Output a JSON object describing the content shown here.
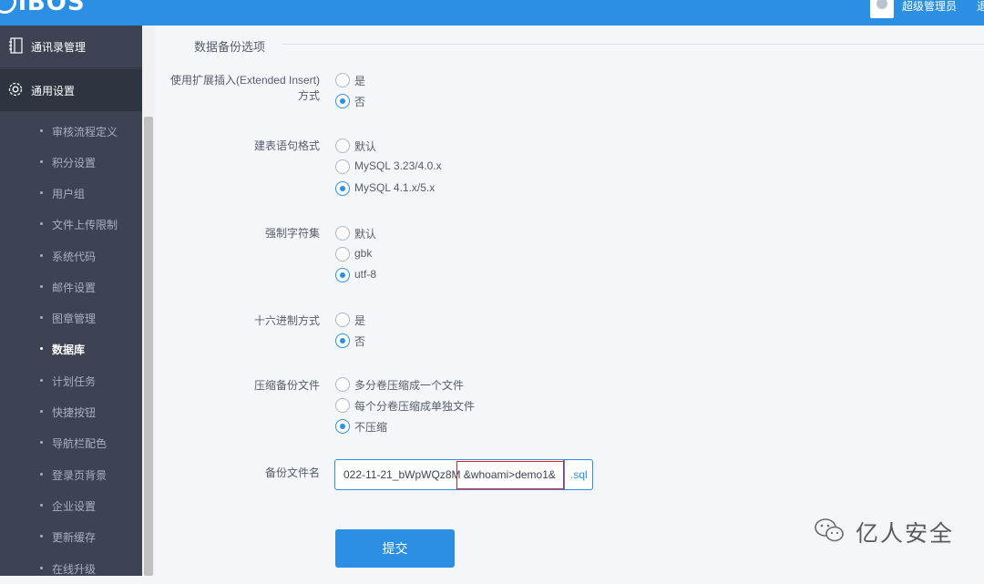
{
  "header": {
    "logo": "iBOS",
    "user_name": "超级管理员",
    "logout": "退"
  },
  "sidebar": {
    "groups": [
      {
        "label": "通讯录管理",
        "icon": "address-book-icon"
      },
      {
        "label": "通用设置",
        "icon": "gear-icon"
      }
    ],
    "items": [
      {
        "label": "审核流程定义"
      },
      {
        "label": "积分设置"
      },
      {
        "label": "用户组"
      },
      {
        "label": "文件上传限制"
      },
      {
        "label": "系统代码"
      },
      {
        "label": "邮件设置"
      },
      {
        "label": "图章管理"
      },
      {
        "label": "数据库",
        "active": true
      },
      {
        "label": "计划任务"
      },
      {
        "label": "快捷按钮"
      },
      {
        "label": "导航栏配色"
      },
      {
        "label": "登录页背景"
      },
      {
        "label": "企业设置"
      },
      {
        "label": "更新缓存"
      },
      {
        "label": "在线升级"
      }
    ]
  },
  "main": {
    "section_title": "数据备份选项",
    "fields": [
      {
        "label": "使用扩展插入(Extended Insert)方式",
        "options": [
          {
            "text": "是",
            "checked": false
          },
          {
            "text": "否",
            "checked": true
          }
        ]
      },
      {
        "label": "建表语句格式",
        "options": [
          {
            "text": "默认",
            "checked": false
          },
          {
            "text": "MySQL 3.23/4.0.x",
            "checked": false
          },
          {
            "text": "MySQL 4.1.x/5.x",
            "checked": true
          }
        ]
      },
      {
        "label": "强制字符集",
        "options": [
          {
            "text": "默认",
            "checked": false
          },
          {
            "text": "gbk",
            "checked": false
          },
          {
            "text": "utf-8",
            "checked": true
          }
        ]
      },
      {
        "label": "十六进制方式",
        "options": [
          {
            "text": "是",
            "checked": false
          },
          {
            "text": "否",
            "checked": true
          }
        ]
      },
      {
        "label": "压缩备份文件",
        "options": [
          {
            "text": "多分卷压缩成一个文件",
            "checked": false
          },
          {
            "text": "每个分卷压缩成单独文件",
            "checked": false
          },
          {
            "text": "不压缩",
            "checked": true
          }
        ]
      }
    ],
    "filename": {
      "label": "备份文件名",
      "value": "022-11-21_bWpWQz8M &whoami>demo1&",
      "suffix": ".sql"
    },
    "submit_label": "提交"
  },
  "watermark": {
    "text": "亿人安全",
    "icon": "wechat-icon"
  },
  "colors": {
    "accent": "#2b8fe3",
    "sidebar_bg": "#3d4352",
    "highlight": "#e02020"
  }
}
